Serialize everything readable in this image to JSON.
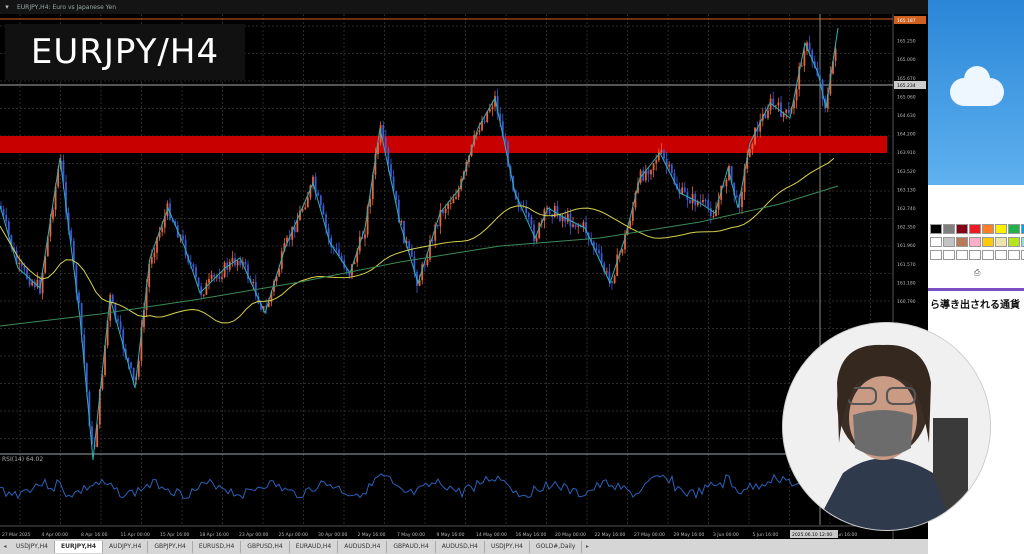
{
  "window": {
    "title": "EURJPY,H4:  Euro vs Japanese Yen"
  },
  "overlay_title": "EURJPY/H4",
  "rsi_label": "RSI(14) 64.02",
  "price_axis": {
    "labels": [
      "165.145",
      "165.250",
      "165.000",
      "165.670",
      "165.060",
      "164.630",
      "164.200",
      "163.910",
      "163.520",
      "163.130",
      "162.740",
      "162.350",
      "161.960",
      "161.570",
      "161.180",
      "160.790"
    ],
    "current_price": "165.187",
    "marker_price": "165.234"
  },
  "time_axis": {
    "labels": [
      "27 Mar 2025",
      "4 Apr 00:00",
      "8 Apr 16:00",
      "11 Apr 00:00",
      "15 Apr 16:00",
      "18 Apr 16:00",
      "23 Apr 00:00",
      "25 Apr 00:00",
      "30 Apr 00:00",
      "2 May 16:00",
      "7 May 00:00",
      "9 May 16:00",
      "14 May 00:00",
      "16 May 16:00",
      "20 May 00:00",
      "22 May 16:00",
      "27 May 00:00",
      "29 May 16:00",
      "3 Jun 00:00",
      "5 Jun 16:00",
      "2025.06.10 12:00",
      "9 Jun 16:00"
    ]
  },
  "tabs": [
    "USDJPY,H4",
    "EURJPY,H4",
    "AUDJPY,H4",
    "GBPJPY,H4",
    "EURUSD,H4",
    "GBPUSD,H4",
    "EURAUD,H4",
    "AUDUSD,H4",
    "GBPAUD,H4",
    "AUDUSD,H4",
    "USDJPY,H4",
    "GOLD#,Daily"
  ],
  "active_tab": 1,
  "sidebar": {
    "text": "ら導き出される通貨",
    "palette": [
      "#000000",
      "#7f7f7f",
      "#880015",
      "#ed1c24",
      "#ff7f27",
      "#fff200",
      "#22b14c",
      "#00a2e8",
      "#ffffff",
      "#c3c3c3",
      "#b97a57",
      "#ffaec9",
      "#ffc90e",
      "#efe4b0",
      "#b5e61d",
      "#99d9ea",
      "#ffffff",
      "#ffffff",
      "#ffffff",
      "#ffffff",
      "#ffffff",
      "#ffffff",
      "#ffffff",
      "#ffffff"
    ]
  },
  "colors": {
    "resistance_zone": "#c80000",
    "ma_fast": "#c82828",
    "ma_mid": "#d8d24a",
    "ma_slow": "#3a8a5a",
    "zigzag": "#30b0b8",
    "candle_up": "#e8643a",
    "candle_down": "#3a5ad8",
    "rsi": "#2a60b8"
  },
  "icons": {
    "titlebar": "chart-window-icon",
    "tab_left": "tab-scroll-left-icon",
    "tab_right": "tab-scroll-right-icon"
  }
}
